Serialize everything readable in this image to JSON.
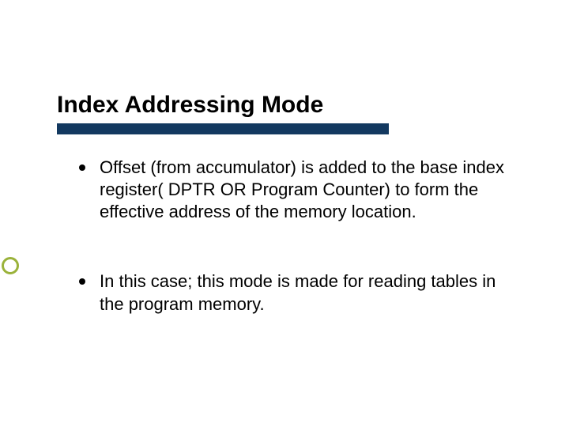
{
  "title": "Index Addressing Mode",
  "bullets": [
    "Offset (from accumulator) is added to the base index register( DPTR OR Program Counter) to form the effective address of the memory location.",
    "In this case; this mode is made for reading tables in the program memory."
  ],
  "colors": {
    "title_bar": "#133960",
    "accent": "#9ab23a"
  }
}
